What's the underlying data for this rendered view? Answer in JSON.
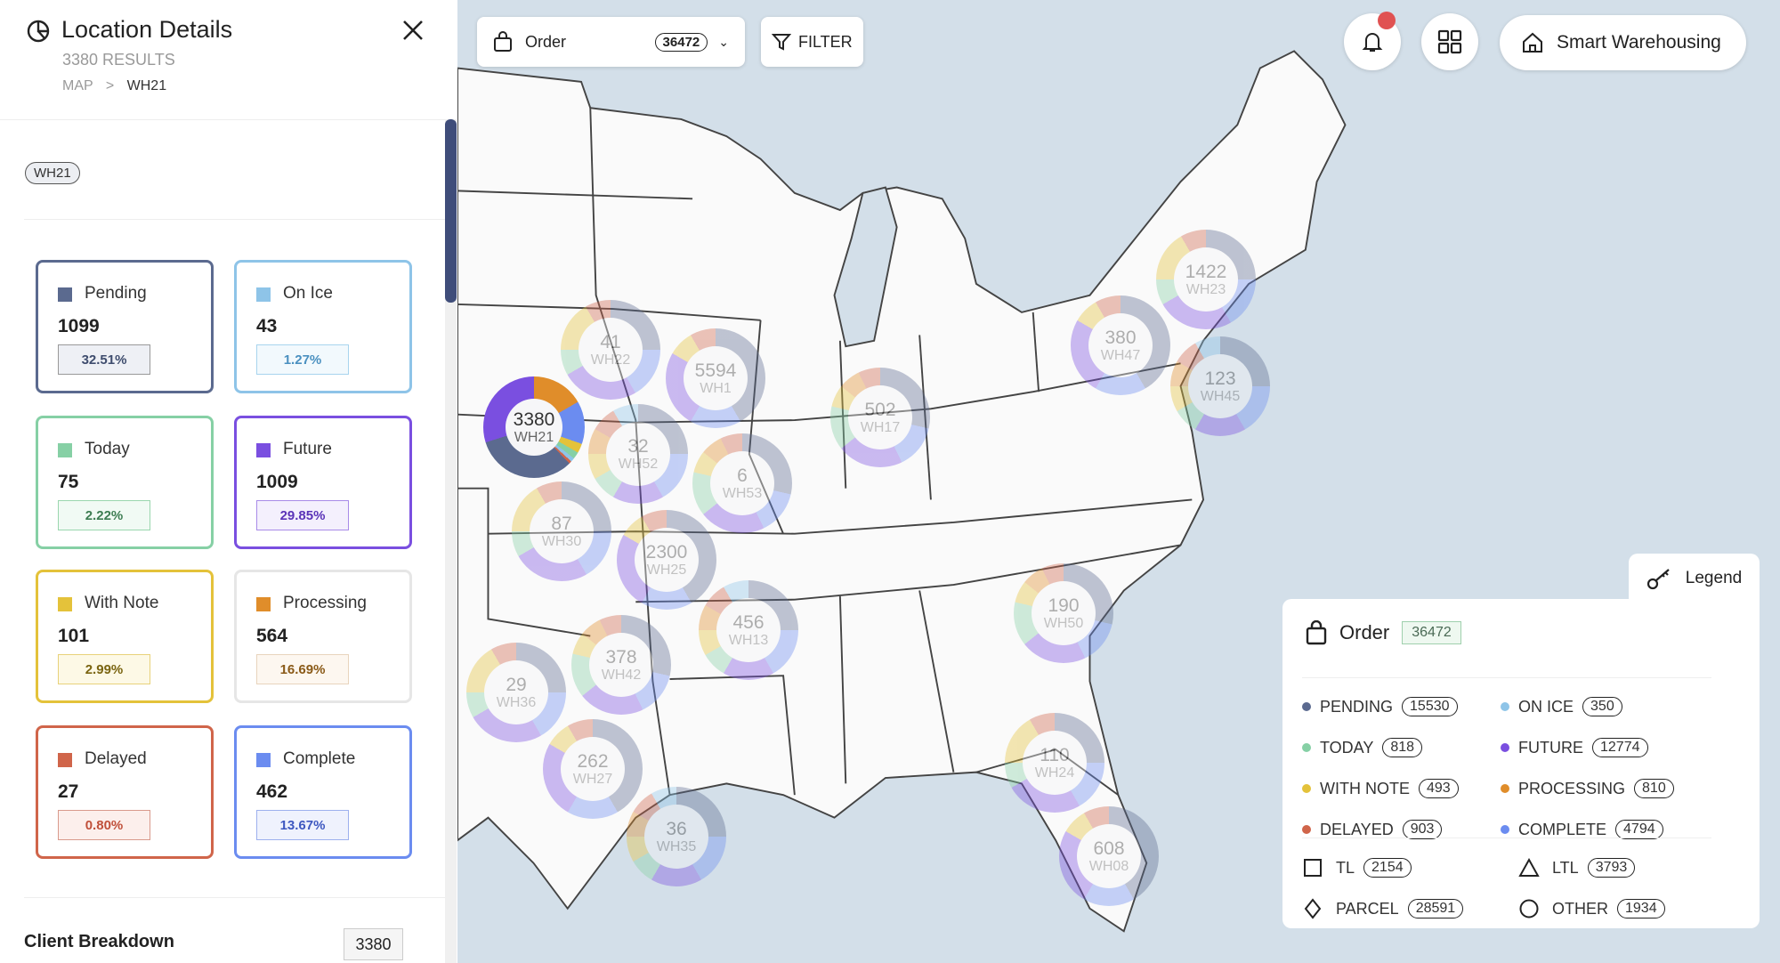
{
  "colors": {
    "pending": "#5b6a8f",
    "on_ice": "#8ec4e8",
    "today": "#86d0a5",
    "future": "#7a4fe0",
    "with_note": "#e4c23a",
    "processing": "#e08d2a",
    "delayed": "#d0654a",
    "complete": "#6b8cf0",
    "map_water": "#d3dfe9",
    "map_land": "#fafafa",
    "notification": "#e05252"
  },
  "panel": {
    "title": "Location Details",
    "results": "3380 RESULTS",
    "breadcrumb": {
      "root": "MAP",
      "sep": ">",
      "current": "WH21"
    },
    "chip": "WH21",
    "cards": [
      {
        "key": "pending",
        "label": "Pending",
        "count": "1099",
        "pct": "32.51%"
      },
      {
        "key": "on_ice",
        "label": "On Ice",
        "count": "43",
        "pct": "1.27%"
      },
      {
        "key": "today",
        "label": "Today",
        "count": "75",
        "pct": "2.22%"
      },
      {
        "key": "future",
        "label": "Future",
        "count": "1009",
        "pct": "29.85%"
      },
      {
        "key": "with_note",
        "label": "With Note",
        "count": "101",
        "pct": "2.99%"
      },
      {
        "key": "processing",
        "label": "Processing",
        "count": "564",
        "pct": "16.69%"
      },
      {
        "key": "delayed",
        "label": "Delayed",
        "count": "27",
        "pct": "0.80%"
      },
      {
        "key": "complete",
        "label": "Complete",
        "count": "462",
        "pct": "13.67%"
      }
    ],
    "client_breakdown": {
      "label": "Client Breakdown",
      "count": "3380"
    }
  },
  "toolbar": {
    "order_label": "Order",
    "order_count": "36472",
    "filter_label": "FILTER",
    "app_label": "Smart Warehousing"
  },
  "clusters": [
    {
      "count": "3380",
      "wh": "WH21",
      "selected": true
    },
    {
      "count": "41",
      "wh": "WH22"
    },
    {
      "count": "5594",
      "wh": "WH1"
    },
    {
      "count": "32",
      "wh": "WH52"
    },
    {
      "count": "6",
      "wh": "WH53"
    },
    {
      "count": "87",
      "wh": "WH30"
    },
    {
      "count": "2300",
      "wh": "WH25"
    },
    {
      "count": "456",
      "wh": "WH13"
    },
    {
      "count": "378",
      "wh": "WH42"
    },
    {
      "count": "29",
      "wh": "WH36"
    },
    {
      "count": "262",
      "wh": "WH27"
    },
    {
      "count": "36",
      "wh": "WH35"
    },
    {
      "count": "502",
      "wh": "WH17"
    },
    {
      "count": "1422",
      "wh": "WH23"
    },
    {
      "count": "380",
      "wh": "WH47"
    },
    {
      "count": "123",
      "wh": "WH45"
    },
    {
      "count": "190",
      "wh": "WH50"
    },
    {
      "count": "110",
      "wh": "WH24"
    },
    {
      "count": "608",
      "wh": "WH08"
    }
  ],
  "legend": {
    "tab": "Legend",
    "order_label": "Order",
    "order_total": "36472",
    "statuses": [
      {
        "key": "pending",
        "label": "PENDING",
        "count": "15530"
      },
      {
        "key": "on_ice",
        "label": "ON ICE",
        "count": "350"
      },
      {
        "key": "today",
        "label": "TODAY",
        "count": "818"
      },
      {
        "key": "future",
        "label": "FUTURE",
        "count": "12774"
      },
      {
        "key": "with_note",
        "label": "WITH NOTE",
        "count": "493"
      },
      {
        "key": "processing",
        "label": "PROCESSING",
        "count": "810"
      },
      {
        "key": "delayed",
        "label": "DELAYED",
        "count": "903"
      },
      {
        "key": "complete",
        "label": "COMPLETE",
        "count": "4794"
      }
    ],
    "modes": [
      {
        "icon": "square-icon",
        "label": "TL",
        "count": "2154"
      },
      {
        "icon": "triangle-icon",
        "label": "LTL",
        "count": "3793"
      },
      {
        "icon": "diamond-icon",
        "label": "PARCEL",
        "count": "28591"
      },
      {
        "icon": "circle-icon",
        "label": "OTHER",
        "count": "1934"
      }
    ]
  }
}
